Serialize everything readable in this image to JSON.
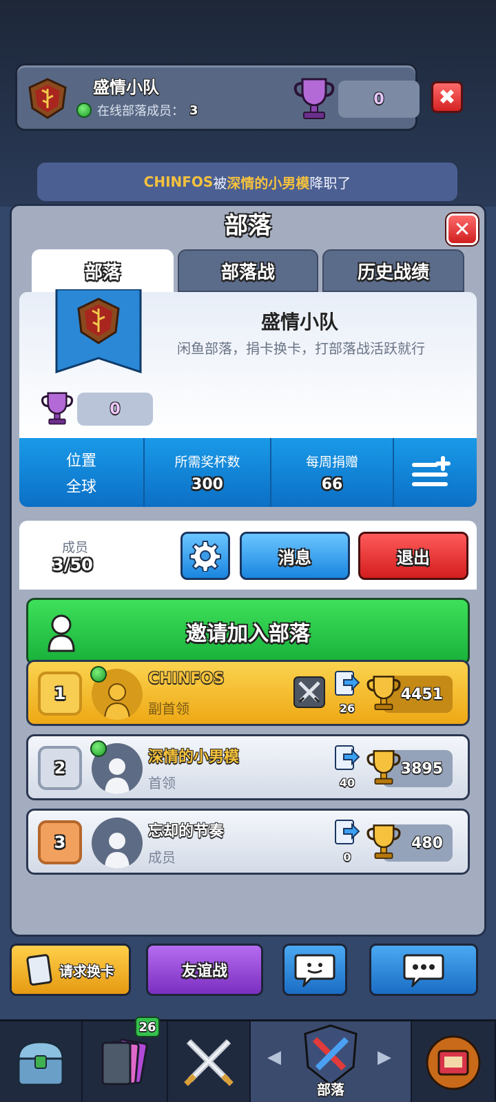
{
  "header": {
    "clan_name": "盛情小队",
    "online_label": "在线部落成员：",
    "online_count": "3",
    "trophies": "0"
  },
  "notification": {
    "actor_target": "CHINFOS",
    "middle": "被",
    "actor": "深情的小男模",
    "tail": "降职了"
  },
  "panel": {
    "title": "部落",
    "tabs": [
      "部落",
      "部落战",
      "历史战绩"
    ]
  },
  "clan_info": {
    "name": "盛情小队",
    "description": "闲鱼部落，捐卡换卡，打部落战活跃就行",
    "trophies": "0"
  },
  "stats": {
    "location_label": "位置",
    "location_value": "全球",
    "required_label": "所需奖杯数",
    "required_value": "300",
    "weekly_label": "每周捐赠",
    "weekly_value": "66"
  },
  "members_bar": {
    "label": "成员",
    "count": "3/50",
    "message_label": "消息",
    "exit_label": "退出"
  },
  "invite_label": "邀请加入部落",
  "members": [
    {
      "rank": "1",
      "name": "CHINFOS",
      "role": "副首领",
      "donations": "26",
      "trophies": "4451",
      "online": true
    },
    {
      "rank": "2",
      "name": "深情的小男模",
      "role": "首领",
      "donations": "40",
      "trophies": "3895",
      "online": true
    },
    {
      "rank": "3",
      "name": "忘却的节奏",
      "role": "成员",
      "donations": "0",
      "trophies": "480",
      "online": false
    }
  ],
  "actions": {
    "request_label": "请求换卡",
    "friendly_label": "友谊战"
  },
  "nav": {
    "cards_badge": "26",
    "active_label": "部落"
  }
}
